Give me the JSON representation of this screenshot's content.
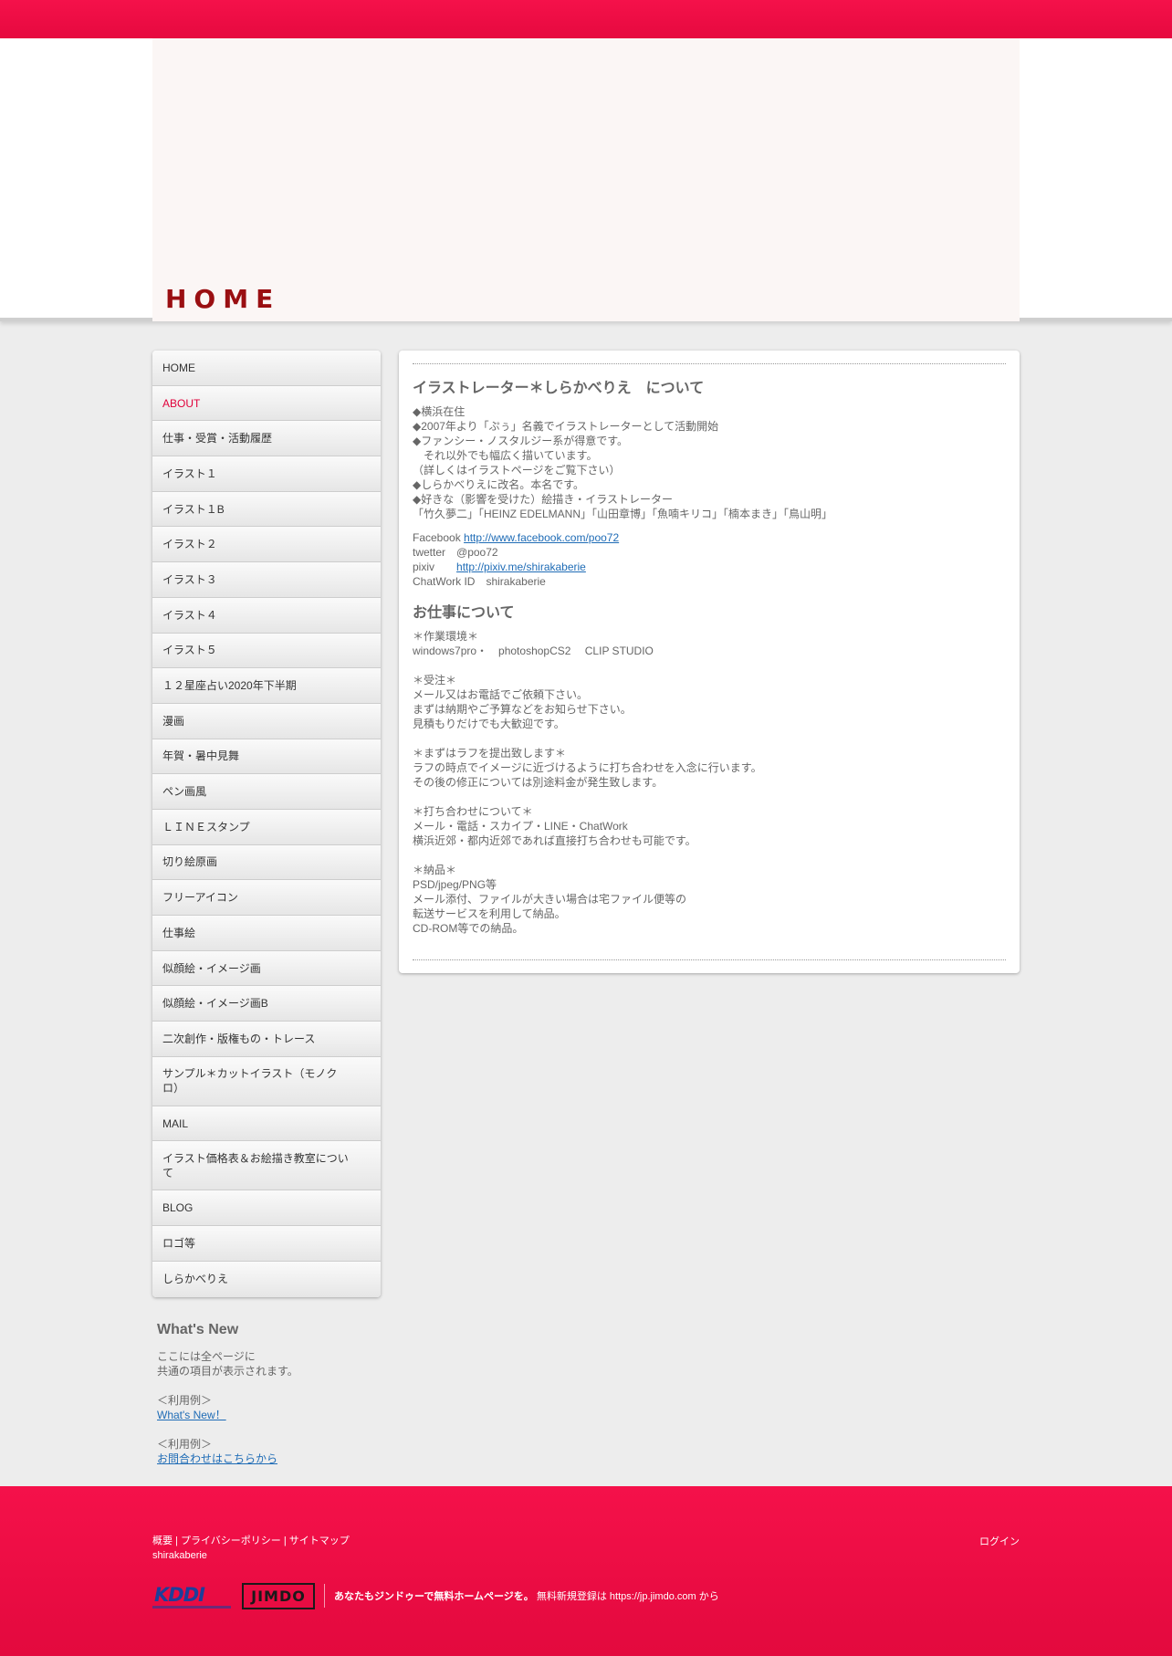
{
  "header": {
    "title": "HOME"
  },
  "nav": [
    {
      "label": "HOME",
      "active": false
    },
    {
      "label": "ABOUT",
      "active": true
    },
    {
      "label": "仕事・受賞・活動履歴",
      "active": false
    },
    {
      "label": "イラスト１",
      "active": false
    },
    {
      "label": "イラスト１B",
      "active": false
    },
    {
      "label": "イラスト２",
      "active": false
    },
    {
      "label": "イラスト３",
      "active": false
    },
    {
      "label": "イラスト４",
      "active": false
    },
    {
      "label": "イラスト５",
      "active": false
    },
    {
      "label": "１２星座占い2020年下半期",
      "active": false
    },
    {
      "label": "漫画",
      "active": false
    },
    {
      "label": "年賀・暑中見舞",
      "active": false
    },
    {
      "label": "ペン画風",
      "active": false
    },
    {
      "label": "ＬＩＮＥスタンプ",
      "active": false
    },
    {
      "label": "切り絵原画",
      "active": false
    },
    {
      "label": "フリーアイコン",
      "active": false
    },
    {
      "label": "仕事絵",
      "active": false
    },
    {
      "label": "似顔絵・イメージ画",
      "active": false
    },
    {
      "label": "似顔絵・イメージ画B",
      "active": false
    },
    {
      "label": "二次創作・版権もの・トレース",
      "active": false
    },
    {
      "label": "サンプル＊カットイラスト（モノクロ）",
      "active": false
    },
    {
      "label": "MAIL",
      "active": false
    },
    {
      "label": "イラスト価格表＆お絵描き教室について",
      "active": false
    },
    {
      "label": "BLOG",
      "active": false
    },
    {
      "label": "ロゴ等",
      "active": false
    },
    {
      "label": "しらかべりえ",
      "active": false
    }
  ],
  "whatsnew": {
    "title": "What's New",
    "line1": "ここには全ページに",
    "line2": "共通の項目が表示されます。",
    "example_label1": "＜利用例＞",
    "link1": "What's New！",
    "example_label2": "＜利用例＞",
    "link2": "お問合わせはこちらから"
  },
  "main": {
    "heading1": "イラストレーター＊しらかべりえ　について",
    "about_lines": [
      "◆横浜在住",
      "◆2007年より「ぷぅ」名義でイラストレーターとして活動開始",
      "◆ファンシー・ノスタルジー系が得意です。",
      "　それ以外でも幅広く描いています。",
      "（詳しくはイラストページをご覧下さい）",
      "◆しらかべりえに改名。本名です。",
      "◆好きな（影響を受けた）絵描き・イラストレーター",
      "「竹久夢二」「HEINZ EDELMANN」「山田章博」「魚喃キリコ」「楠本まき」「鳥山明」"
    ],
    "facebook_label": "Facebook ",
    "facebook_url": "http://www.facebook.com/poo72",
    "twitter_line": "twetter　@poo72",
    "pixiv_label": "pixiv　　",
    "pixiv_url": "http://pixiv.me/shirakaberie",
    "chatwork_line": "ChatWork ID　shirakaberie",
    "heading2": "お仕事について",
    "work_lines": [
      "＊作業環境＊",
      "windows7pro・　photoshopCS2　 CLIP STUDIO",
      "",
      "＊受注＊",
      "メール又はお電話でご依頼下さい。",
      "まずは納期やご予算などをお知らせ下さい。",
      "見積もりだけでも大歓迎です。",
      "",
      "＊まずはラフを提出致します＊",
      "ラフの時点でイメージに近づけるように打ち合わせを入念に行います。",
      "その後の修正については別途料金が発生致します。",
      "",
      "＊打ち合わせについて＊",
      "メール・電話・スカイプ・LINE・ChatWork",
      "横浜近郊・都内近郊であれば直接打ち合わせも可能です。",
      "",
      "＊納品＊",
      "PSD/jpeg/PNG等",
      "メール添付、ファイルが大きい場合は宅ファイル便等の",
      "転送サービスを利用して納品。",
      "CD-ROM等での納品。"
    ]
  },
  "footer": {
    "link_overview": "概要",
    "sep": " | ",
    "link_privacy": "プライバシーポリシー",
    "link_sitemap": "サイトマップ",
    "site_name": "shirakaberie",
    "login": "ログイン",
    "kddi": "KDDI",
    "jimdo": "JIMDO",
    "promo_bold": "あなたもジンドゥーで無料ホームページを。",
    "promo_rest": " 無料新規登録は https://jp.jimdo.com から",
    "colors": {
      "bar": "#f5114a",
      "title": "#9a0f12",
      "active": "#e0003a",
      "link": "#1f6cb6"
    }
  }
}
